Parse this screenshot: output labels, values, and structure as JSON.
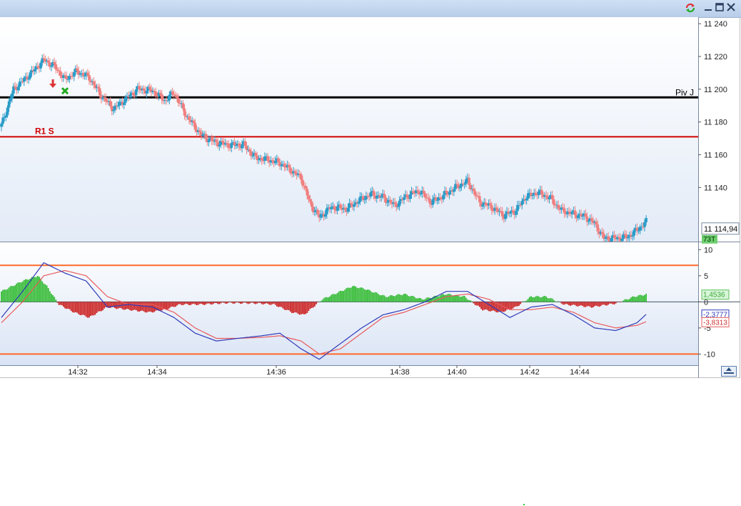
{
  "window": {
    "buttons": [
      "refresh",
      "minimize",
      "maximize",
      "close"
    ],
    "icons": {
      "refresh": "refresh-icon",
      "minimize": "minimize-icon",
      "maximize": "maximize-icon",
      "close": "close-icon"
    }
  },
  "colors": {
    "bull": "#2a9cc8",
    "bear": "#f08080",
    "pivot": "#000000",
    "r1": "#d00000",
    "macd_line": "#2e3ab8",
    "signal_line": "#e85a5a",
    "hist_pos": "#33bb33",
    "hist_neg": "#cc2222",
    "osc_levels": "#ff6a2a"
  },
  "chart_data": [
    {
      "type": "candlestick",
      "yticks": [
        "11 240",
        "11 220",
        "11 200",
        "11 180",
        "11 160",
        "11 140"
      ],
      "ylim": [
        11107,
        11244
      ],
      "levels": [
        {
          "label": "Piv J",
          "value": 11195
        },
        {
          "label": "R1 S",
          "value": 11171
        }
      ],
      "last_price": "11 114,94",
      "tick_count_badge": "73T",
      "path": [
        [
          0,
          11178
        ],
        [
          8,
          11200
        ],
        [
          14,
          11205
        ],
        [
          22,
          11212
        ],
        [
          28,
          11218
        ],
        [
          35,
          11214
        ],
        [
          42,
          11206
        ],
        [
          50,
          11211
        ],
        [
          58,
          11207
        ],
        [
          66,
          11196
        ],
        [
          74,
          11188
        ],
        [
          82,
          11194
        ],
        [
          90,
          11200
        ],
        [
          100,
          11199
        ],
        [
          108,
          11193
        ],
        [
          114,
          11198
        ],
        [
          122,
          11184
        ],
        [
          132,
          11172
        ],
        [
          140,
          11168
        ],
        [
          150,
          11166
        ],
        [
          160,
          11166
        ],
        [
          168,
          11158
        ],
        [
          176,
          11157
        ],
        [
          184,
          11155
        ],
        [
          192,
          11150
        ],
        [
          198,
          11146
        ],
        [
          204,
          11130
        ],
        [
          210,
          11122
        ],
        [
          218,
          11128
        ],
        [
          228,
          11127
        ],
        [
          236,
          11132
        ],
        [
          244,
          11136
        ],
        [
          252,
          11134
        ],
        [
          260,
          11129
        ],
        [
          268,
          11135
        ],
        [
          276,
          11138
        ],
        [
          284,
          11131
        ],
        [
          292,
          11135
        ],
        [
          300,
          11140
        ],
        [
          308,
          11144
        ],
        [
          316,
          11131
        ],
        [
          324,
          11128
        ],
        [
          332,
          11123
        ],
        [
          340,
          11126
        ],
        [
          346,
          11134
        ],
        [
          354,
          11137
        ],
        [
          362,
          11134
        ],
        [
          370,
          11126
        ],
        [
          378,
          11124
        ],
        [
          386,
          11122
        ],
        [
          392,
          11118
        ],
        [
          398,
          11109
        ],
        [
          406,
          11109
        ],
        [
          414,
          11110
        ],
        [
          420,
          11114
        ],
        [
          426,
          11119
        ]
      ]
    },
    {
      "type": "macd",
      "yticks": [
        "10",
        "5",
        "0",
        "-5",
        "-10"
      ],
      "ylim": [
        -12,
        11
      ],
      "levels": [
        7,
        -10
      ],
      "values": {
        "histogram": "1,4536",
        "macd": "-2,3777",
        "signal": "-3,8313"
      },
      "macd": [
        [
          0,
          -3
        ],
        [
          14,
          2
        ],
        [
          28,
          7.5
        ],
        [
          42,
          5.5
        ],
        [
          56,
          4
        ],
        [
          70,
          -1
        ],
        [
          84,
          -0.5
        ],
        [
          100,
          -1
        ],
        [
          114,
          -3
        ],
        [
          128,
          -6
        ],
        [
          142,
          -7.5
        ],
        [
          156,
          -7
        ],
        [
          172,
          -6.5
        ],
        [
          184,
          -6
        ],
        [
          198,
          -9
        ],
        [
          210,
          -11
        ],
        [
          224,
          -8
        ],
        [
          238,
          -5
        ],
        [
          252,
          -2.5
        ],
        [
          266,
          -1.5
        ],
        [
          280,
          0
        ],
        [
          294,
          2
        ],
        [
          308,
          2
        ],
        [
          322,
          -0.5
        ],
        [
          336,
          -3
        ],
        [
          350,
          -1
        ],
        [
          364,
          -0.5
        ],
        [
          378,
          -2.5
        ],
        [
          392,
          -5
        ],
        [
          406,
          -5.5
        ],
        [
          420,
          -4
        ],
        [
          426,
          -2.4
        ]
      ],
      "signal": [
        [
          0,
          -4
        ],
        [
          14,
          0
        ],
        [
          28,
          5
        ],
        [
          42,
          6
        ],
        [
          56,
          5
        ],
        [
          70,
          1
        ],
        [
          84,
          -0.5
        ],
        [
          100,
          -0.5
        ],
        [
          114,
          -2
        ],
        [
          128,
          -5
        ],
        [
          142,
          -7
        ],
        [
          156,
          -7
        ],
        [
          172,
          -6.8
        ],
        [
          184,
          -6.5
        ],
        [
          198,
          -7.5
        ],
        [
          210,
          -10
        ],
        [
          224,
          -9
        ],
        [
          238,
          -6
        ],
        [
          252,
          -3
        ],
        [
          266,
          -2
        ],
        [
          280,
          -0.5
        ],
        [
          294,
          1
        ],
        [
          308,
          1.5
        ],
        [
          322,
          0.5
        ],
        [
          336,
          -1.5
        ],
        [
          350,
          -1.5
        ],
        [
          364,
          -1
        ],
        [
          378,
          -2
        ],
        [
          392,
          -4
        ],
        [
          406,
          -5
        ],
        [
          420,
          -4.5
        ],
        [
          426,
          -3.8
        ]
      ],
      "histogram": [
        [
          0,
          2
        ],
        [
          14,
          4
        ],
        [
          24,
          5
        ],
        [
          30,
          3
        ],
        [
          38,
          -0.5
        ],
        [
          48,
          -2
        ],
        [
          58,
          -3
        ],
        [
          70,
          -1
        ],
        [
          84,
          -1.5
        ],
        [
          98,
          -2
        ],
        [
          108,
          -1.5
        ],
        [
          118,
          -0.5
        ],
        [
          132,
          -0.5
        ],
        [
          150,
          -0.2
        ],
        [
          170,
          -0.3
        ],
        [
          180,
          -0.5
        ],
        [
          192,
          -2
        ],
        [
          200,
          -2.5
        ],
        [
          212,
          0.5
        ],
        [
          224,
          2
        ],
        [
          232,
          3
        ],
        [
          240,
          2.5
        ],
        [
          254,
          1
        ],
        [
          266,
          1.5
        ],
        [
          278,
          0.5
        ],
        [
          294,
          1.5
        ],
        [
          306,
          1
        ],
        [
          318,
          -1.5
        ],
        [
          330,
          -2
        ],
        [
          340,
          -1
        ],
        [
          350,
          1
        ],
        [
          360,
          1
        ],
        [
          372,
          -0.5
        ],
        [
          390,
          -1
        ],
        [
          406,
          -0.3
        ],
        [
          418,
          1
        ],
        [
          426,
          1.45
        ]
      ]
    }
  ],
  "time_axis": {
    "labels": [
      "14:32",
      "14:34",
      "14:36",
      "14:38",
      "14:40",
      "14:42",
      "14:44"
    ],
    "positions": [
      0,
      2,
      5,
      8,
      9.5,
      11,
      12.3
    ]
  },
  "markers": [
    {
      "type": "down-arrow",
      "bar": 34,
      "price": 11203
    },
    {
      "type": "x-mark",
      "bar": 42,
      "price": 11199
    }
  ]
}
